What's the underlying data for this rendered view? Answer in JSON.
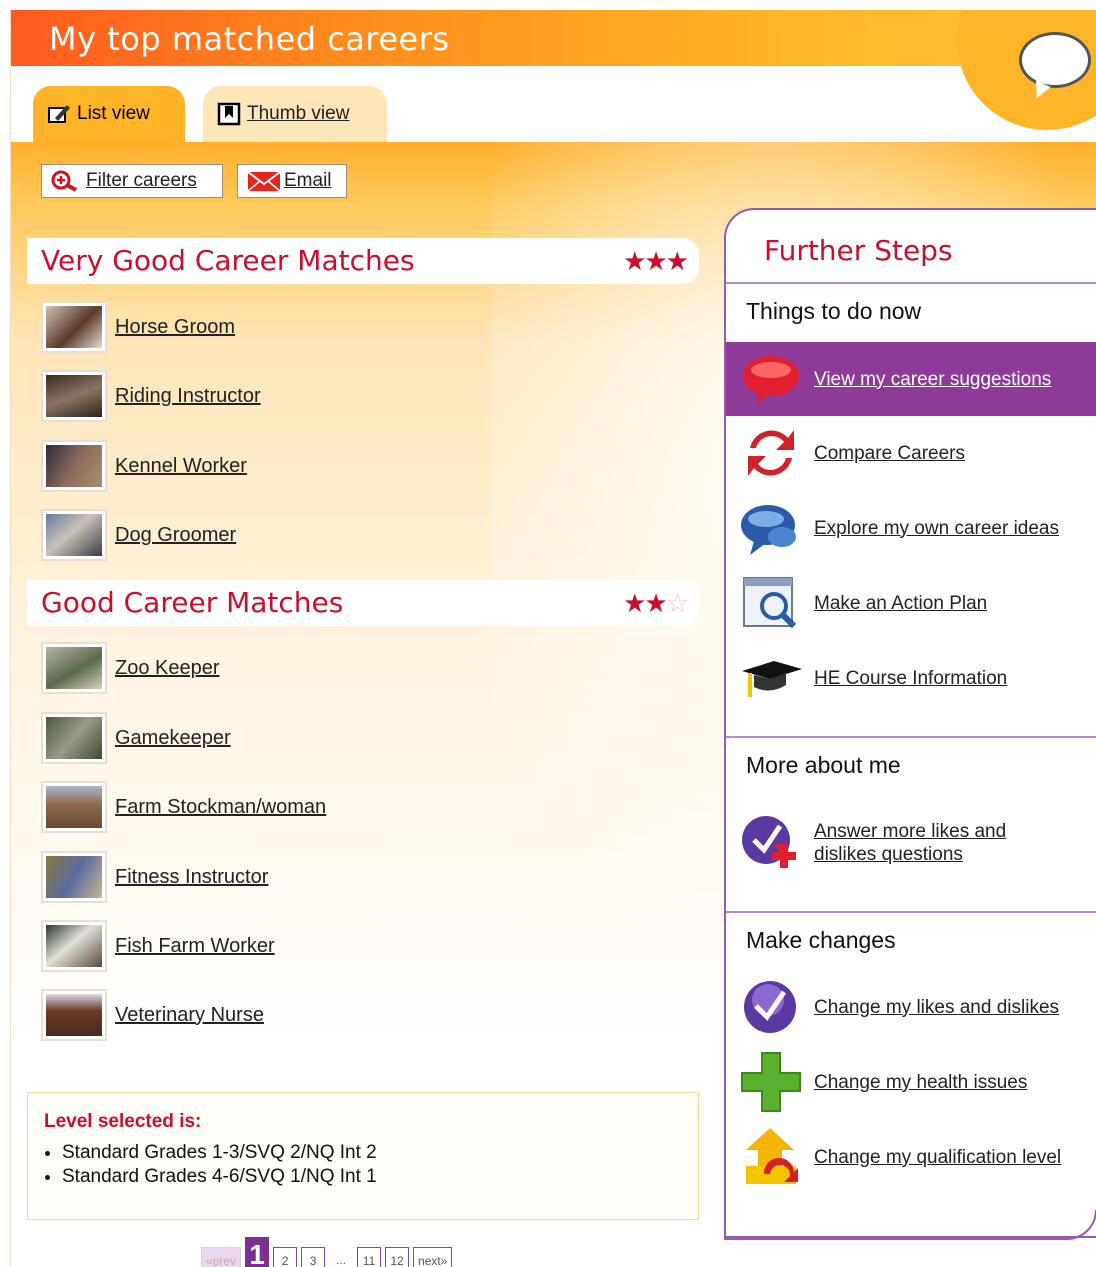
{
  "title": "My top matched careers",
  "tabs": [
    {
      "label": "List view",
      "active": true,
      "icon": "pencil-list-icon"
    },
    {
      "label": "Thumb view",
      "active": false,
      "icon": "bookmark-icon"
    }
  ],
  "toolbar": {
    "filter_label": "Filter careers",
    "email_label": "Email"
  },
  "sections": {
    "very_good": {
      "title": "Very Good Career Matches",
      "stars": "★★★",
      "careers": [
        "Horse Groom",
        "Riding Instructor",
        "Kennel Worker",
        "Dog Groomer"
      ]
    },
    "good": {
      "title": "Good Career Matches",
      "stars": "★★",
      "empty_stars": "☆",
      "careers": [
        "Zoo Keeper",
        "Gamekeeper",
        "Farm Stockman/woman",
        "Fitness Instructor",
        "Fish Farm Worker",
        "Veterinary Nurse"
      ]
    }
  },
  "level": {
    "title": "Level selected is:",
    "items": [
      "Standard Grades 1-3/SVQ 2/NQ Int 2",
      "Standard Grades 4-6/SVQ 1/NQ Int 1"
    ]
  },
  "pager": {
    "prev": "«prev",
    "current": "1",
    "pages": [
      "2",
      "3",
      "11",
      "12"
    ],
    "ellipsis": "...",
    "next": "next»"
  },
  "side": {
    "title": "Further Steps",
    "things": {
      "heading": "Things to do now",
      "items": [
        "View my career suggestions",
        "Compare Careers",
        "Explore my own career ideas",
        "Make an Action Plan",
        "HE Course Information"
      ]
    },
    "more": {
      "heading": "More about me",
      "items": [
        "Answer more likes and dislikes questions"
      ]
    },
    "changes": {
      "heading": "Make changes",
      "items": [
        "Change my likes and dislikes",
        "Change my health issues",
        "Change my qualification level"
      ]
    }
  },
  "colors": {
    "accent_red": "#c8102e",
    "purple": "#8e3a99",
    "orange": "#ff8a1d"
  }
}
